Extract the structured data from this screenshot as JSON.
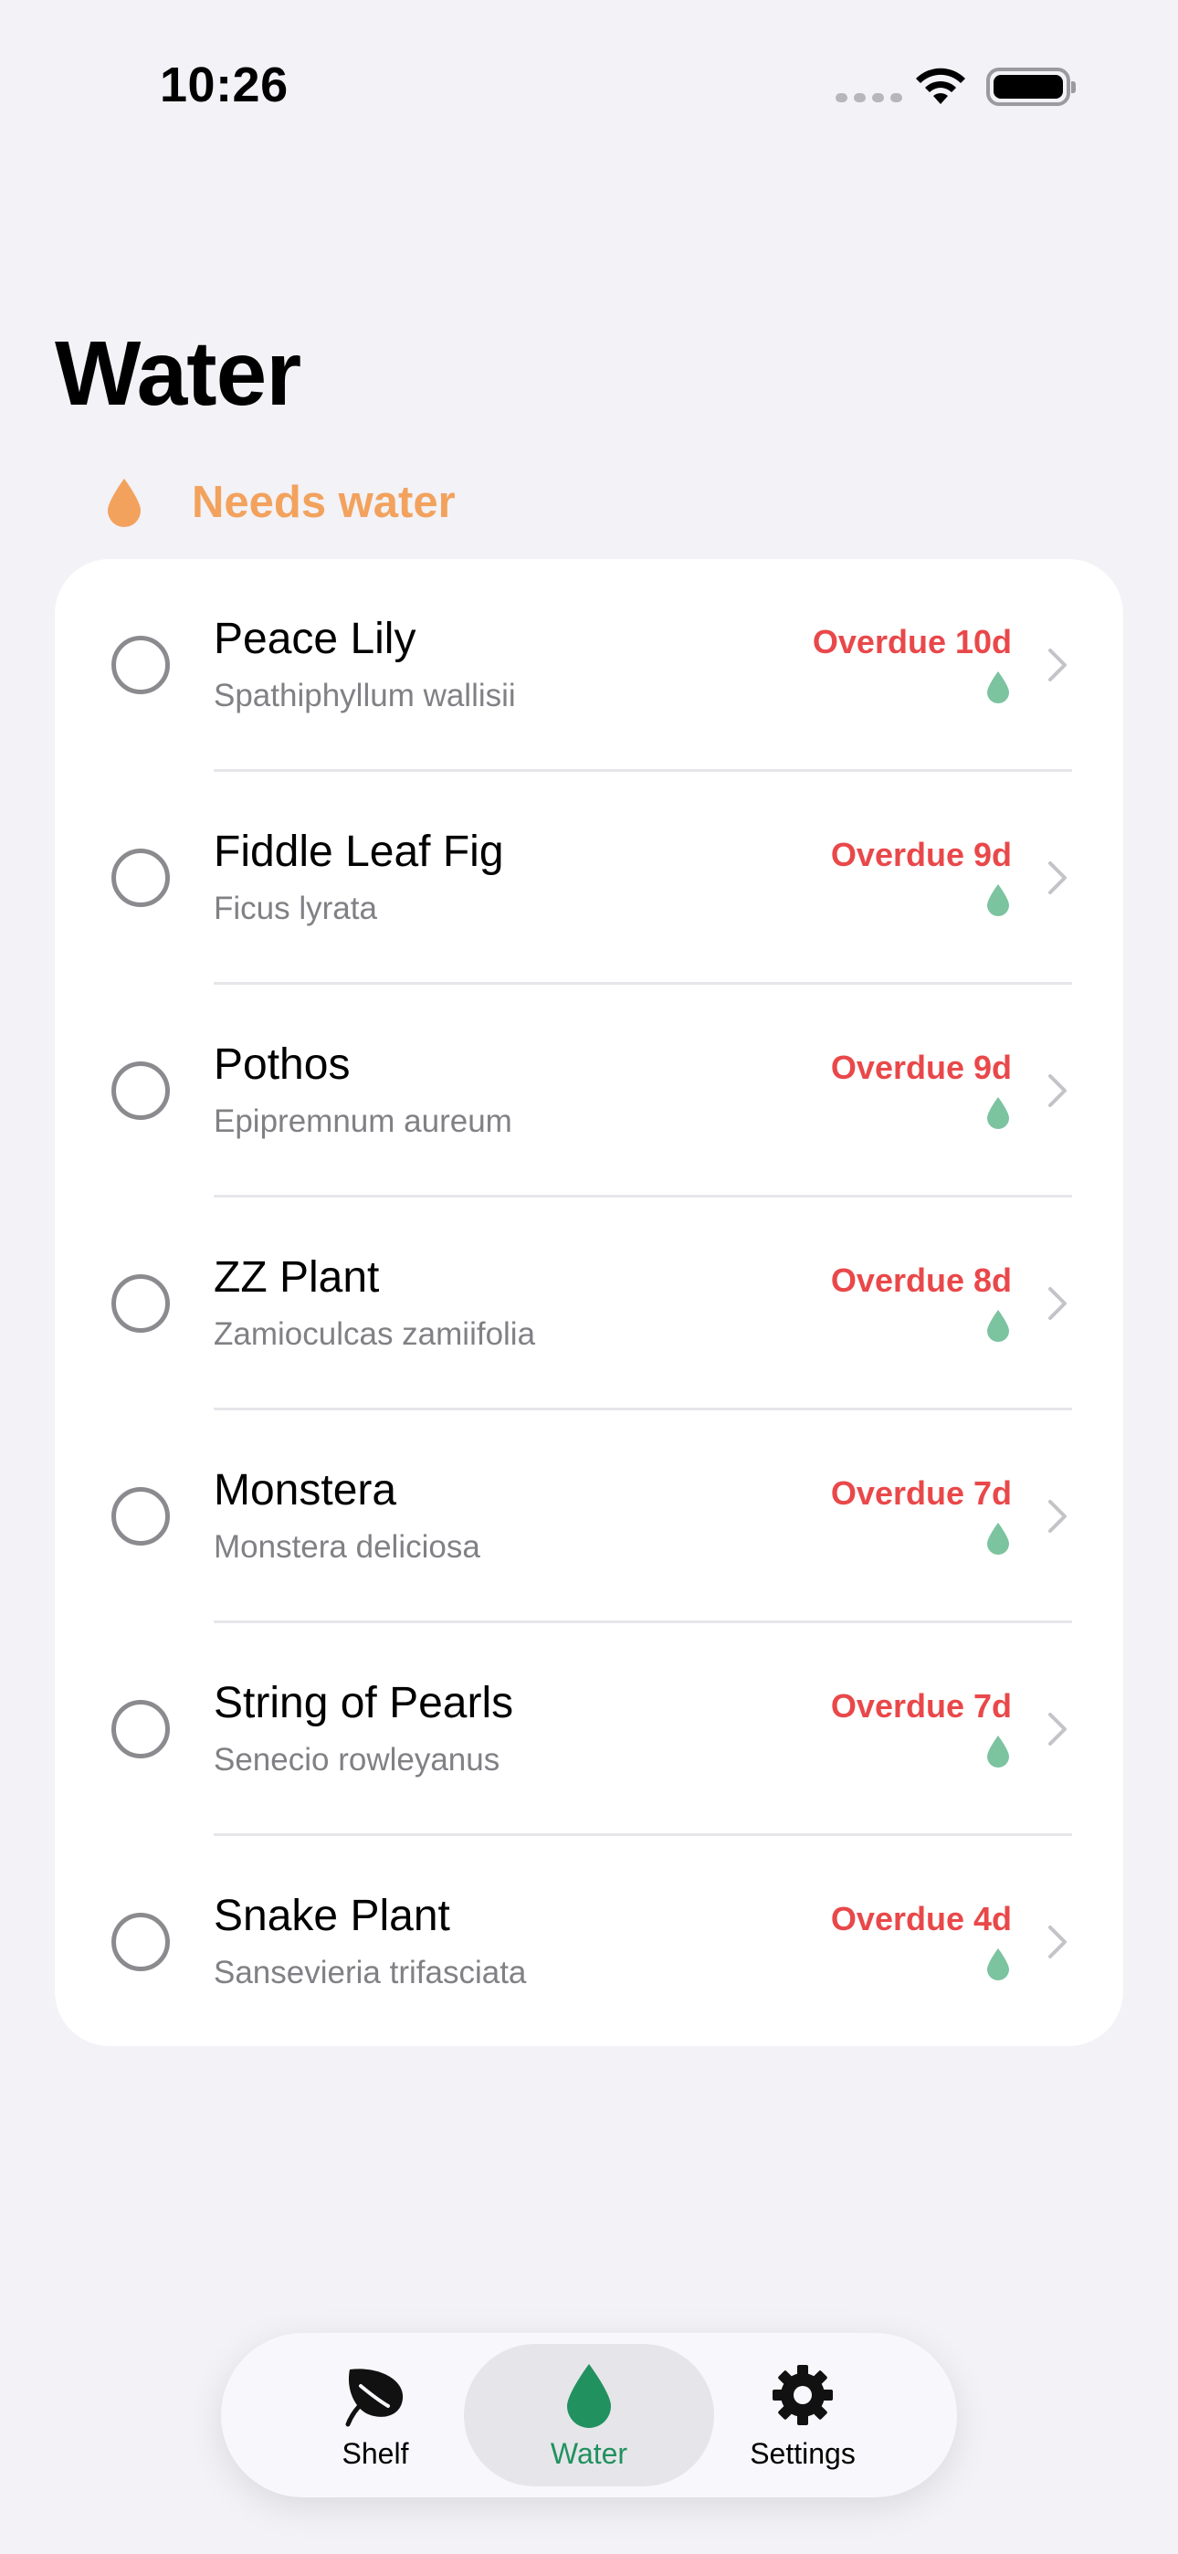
{
  "status_bar": {
    "time": "10:26"
  },
  "page": {
    "title": "Water"
  },
  "section": {
    "label": "Needs water"
  },
  "plants": [
    {
      "name": "Peace Lily",
      "scientific": "Spathiphyllum wallisii",
      "status": "Overdue 10d"
    },
    {
      "name": "Fiddle Leaf Fig",
      "scientific": "Ficus lyrata",
      "status": "Overdue 9d"
    },
    {
      "name": "Pothos",
      "scientific": "Epipremnum aureum",
      "status": "Overdue 9d"
    },
    {
      "name": "ZZ Plant",
      "scientific": "Zamioculcas zamiifolia",
      "status": "Overdue 8d"
    },
    {
      "name": "Monstera",
      "scientific": "Monstera deliciosa",
      "status": "Overdue 7d"
    },
    {
      "name": "String of Pearls",
      "scientific": "Senecio rowleyanus",
      "status": "Overdue 7d"
    },
    {
      "name": "Snake Plant",
      "scientific": "Sansevieria trifasciata",
      "status": "Overdue 4d"
    }
  ],
  "tabs": [
    {
      "label": "Shelf",
      "icon": "leaf-icon",
      "active": false
    },
    {
      "label": "Water",
      "icon": "water-drop-icon",
      "active": true
    },
    {
      "label": "Settings",
      "icon": "gear-icon",
      "active": false
    }
  ],
  "colors": {
    "accent_green": "#21915f",
    "overdue_red": "#e9484a",
    "needs_water_orange": "#f3a25d",
    "mini_drop_green": "#7cc3a0"
  }
}
